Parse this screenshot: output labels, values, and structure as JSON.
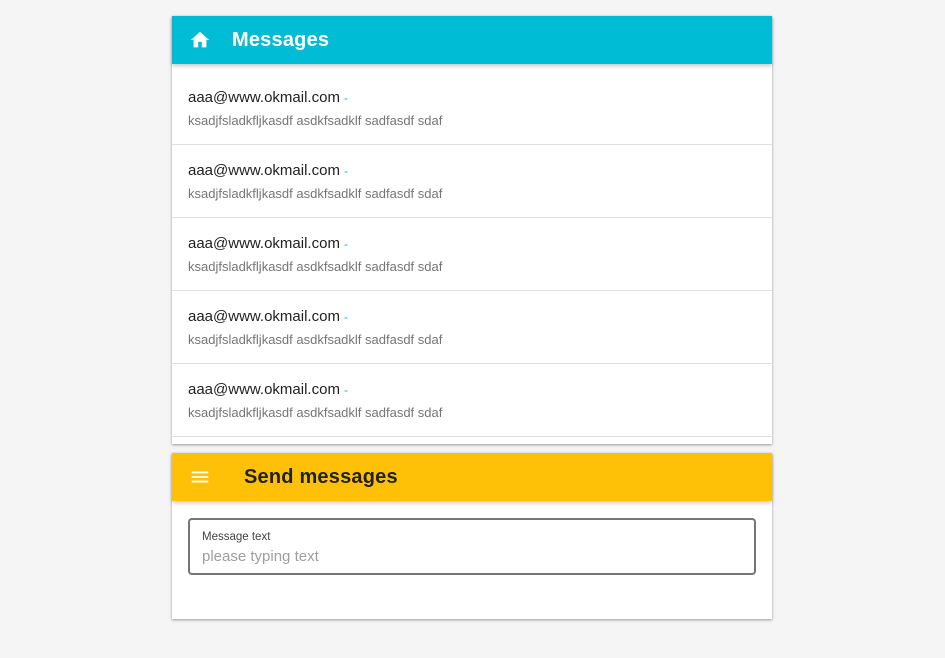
{
  "messages_panel": {
    "title": "Messages",
    "icon": "home-icon",
    "accent_color": "#00bcd4",
    "items": [
      {
        "sender": "aaa@www.okmail.com",
        "separator": "-",
        "text": "ksadjfsladkfljkasdf asdkfsadklf sadfasdf sdaf"
      },
      {
        "sender": "aaa@www.okmail.com",
        "separator": "-",
        "text": "ksadjfsladkfljkasdf asdkfsadklf sadfasdf sdaf"
      },
      {
        "sender": "aaa@www.okmail.com",
        "separator": "-",
        "text": "ksadjfsladkfljkasdf asdkfsadklf sadfasdf sdaf"
      },
      {
        "sender": "aaa@www.okmail.com",
        "separator": "-",
        "text": "ksadjfsladkfljkasdf asdkfsadklf sadfasdf sdaf"
      },
      {
        "sender": "aaa@www.okmail.com",
        "separator": "-",
        "text": "ksadjfsladkfljkasdf asdkfsadklf sadfasdf sdaf"
      }
    ]
  },
  "send_panel": {
    "title": "Send messages",
    "icon": "menu-icon",
    "accent_color": "#ffc107",
    "field": {
      "label": "Message text",
      "value": "",
      "placeholder": "please typing text"
    }
  }
}
